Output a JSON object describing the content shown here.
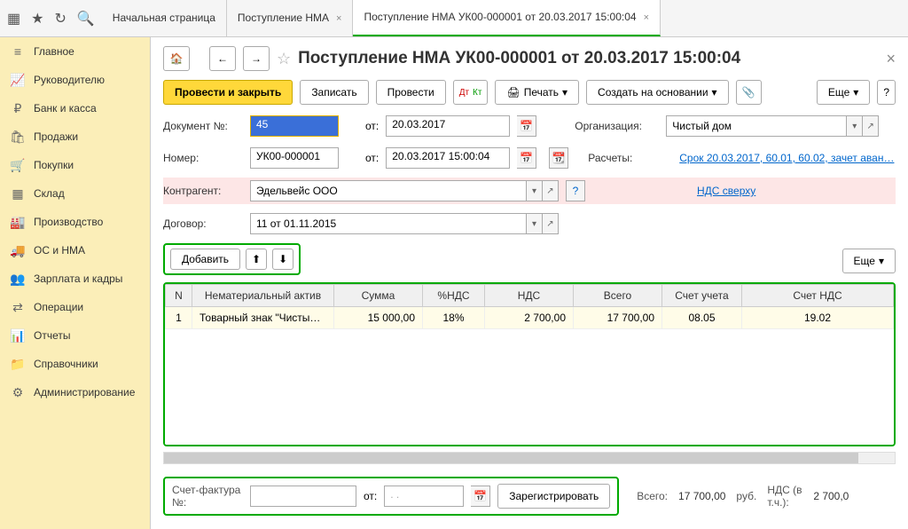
{
  "tabs": [
    {
      "title": "Начальная страница"
    },
    {
      "title": "Поступление НМА"
    },
    {
      "title": "Поступление НМА УК00-000001 от 20.03.2017 15:00:04"
    }
  ],
  "sidebar": {
    "items": [
      {
        "label": "Главное",
        "icon": "≡"
      },
      {
        "label": "Руководителю",
        "icon": "📈"
      },
      {
        "label": "Банк и касса",
        "icon": "₽"
      },
      {
        "label": "Продажи",
        "icon": "🛍"
      },
      {
        "label": "Покупки",
        "icon": "🛒"
      },
      {
        "label": "Склад",
        "icon": "▦"
      },
      {
        "label": "Производство",
        "icon": "🏭"
      },
      {
        "label": "ОС и НМА",
        "icon": "🚚"
      },
      {
        "label": "Зарплата и кадры",
        "icon": "👥"
      },
      {
        "label": "Операции",
        "icon": "⇄"
      },
      {
        "label": "Отчеты",
        "icon": "📊"
      },
      {
        "label": "Справочники",
        "icon": "📁"
      },
      {
        "label": "Администрирование",
        "icon": "⚙"
      }
    ]
  },
  "page": {
    "title": "Поступление НМА УК00-000001 от 20.03.2017 15:00:04"
  },
  "toolbar": {
    "post_close": "Провести и закрыть",
    "save": "Записать",
    "post": "Провести",
    "print": "Печать",
    "create_based": "Создать на основании",
    "more": "Еще"
  },
  "form": {
    "doc_num_label": "Документ №:",
    "doc_num": "45",
    "from_label": "от:",
    "doc_date": "20.03.2017",
    "org_label": "Организация:",
    "org": "Чистый дом",
    "number_label": "Номер:",
    "number": "УК00-000001",
    "number_date": "20.03.2017 15:00:04",
    "calc_label": "Расчеты:",
    "calc_link": "Срок 20.03.2017, 60.01, 60.02, зачет аван…",
    "counterparty_label": "Контрагент:",
    "counterparty": "Эдельвейс ООО",
    "vat_link": "НДС сверху",
    "contract_label": "Договор:",
    "contract": "11 от 01.11.2015",
    "add_btn": "Добавить",
    "table_more": "Еще"
  },
  "table": {
    "headers": [
      "N",
      "Нематериальный актив",
      "Сумма",
      "%НДС",
      "НДС",
      "Всего",
      "Счет учета",
      "Счет НДС"
    ],
    "rows": [
      {
        "n": "1",
        "asset": "Товарный знак \"Чисты…",
        "sum": "15 000,00",
        "vat_pct": "18%",
        "vat": "2 700,00",
        "total": "17 700,00",
        "account": "08.05",
        "vat_account": "19.02"
      }
    ]
  },
  "footer": {
    "invoice_label": "Счет-фактура №:",
    "from_label": "от:",
    "invoice_date": " . .",
    "register_btn": "Зарегистрировать",
    "total_label": "Всего:",
    "total": "17 700,00",
    "currency": "руб.",
    "vat_label": "НДС (в т.ч.):",
    "vat": "2 700,0"
  }
}
